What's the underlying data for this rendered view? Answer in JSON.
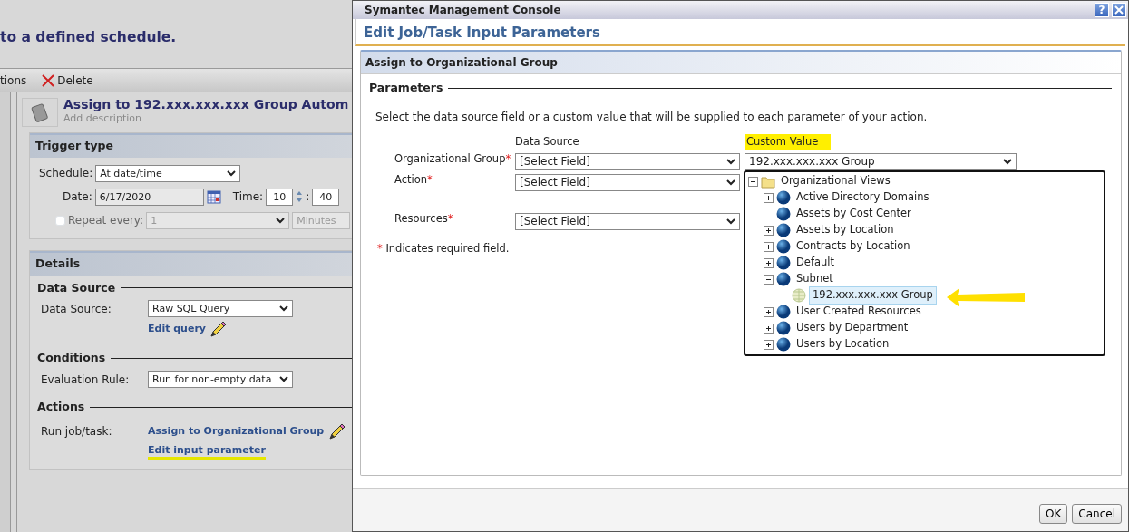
{
  "background_app": {
    "heading": "to a defined schedule.",
    "toolbar": [
      {
        "kind": "text",
        "label": "tions"
      },
      {
        "kind": "delete",
        "label": "Delete"
      }
    ],
    "policy": {
      "title": "Assign to 192.xxx.xxx.xxx Group Autom",
      "description_link": "Add description"
    },
    "trigger": {
      "title": "Trigger type",
      "schedule_label": "Schedule:",
      "schedule_value": "At date/time",
      "date_label": "Date:",
      "date_value": "6/17/2020",
      "time_label": "Time:",
      "hour": "10",
      "separator": ":",
      "minute": "40",
      "repeat_label": "Repeat every:",
      "repeat_checked": false,
      "repeat_value": "1",
      "repeat_unit": "Minutes"
    },
    "details": {
      "title": "Details",
      "data_source": {
        "heading": "Data Source",
        "label": "Data Source:",
        "value": "Raw SQL Query",
        "link": "Edit query"
      },
      "conditions": {
        "heading": "Conditions",
        "label": "Evaluation Rule:",
        "value": "Run for non-empty data"
      },
      "actions": {
        "heading": "Actions",
        "label": "Run job/task:",
        "task_link": "Assign to Organizational Group",
        "param_link": "Edit input parameter",
        "param_link_highlighted": true
      }
    }
  },
  "dialog": {
    "window_title": "Symantec Management Console",
    "help_button": "?",
    "title": "Edit Job/Task Input Parameters",
    "panel_title": "Assign to Organizational Group",
    "section": "Parameters",
    "instructions": "Select the data source field or a custom value that will be supplied to each parameter of your action.",
    "data_source_header": "Data Source",
    "custom_value_header": {
      "text": "Custom Value",
      "highlighted": true
    },
    "parameters": [
      {
        "label": "Organizational Group",
        "required_mark": "*",
        "data_source": "[Select Field]",
        "custom_value": "192.xxx.xxx.xxx Group"
      },
      {
        "label": "Action",
        "required_mark": "*",
        "data_source": "[Select Field]"
      },
      {
        "label": "Resources",
        "required_mark": "*",
        "data_source": "[Select Field]"
      }
    ],
    "required_note": {
      "mark": "*",
      "text": "Indicates required field."
    },
    "tree": [
      {
        "label": "Organizational Views",
        "kind": "folder",
        "expanded": true,
        "selected": false,
        "children": [
          {
            "label": "Active Directory Domains",
            "kind": "view",
            "expanded": false,
            "selected": false
          },
          {
            "label": "Assets by Cost Center",
            "kind": "view",
            "selected": false
          },
          {
            "label": "Assets by Location",
            "kind": "view",
            "expanded": false,
            "selected": false
          },
          {
            "label": "Contracts by Location",
            "kind": "view",
            "expanded": false,
            "selected": false
          },
          {
            "label": "Default",
            "kind": "view",
            "expanded": false,
            "selected": false
          },
          {
            "label": "Subnet",
            "kind": "view",
            "expanded": true,
            "selected": false,
            "children": [
              {
                "label": "192.xxx.xxx.xxx Group",
                "kind": "group",
                "selected": true,
                "annotated": true
              }
            ]
          },
          {
            "label": "User Created Resources",
            "kind": "view",
            "expanded": false,
            "selected": false
          },
          {
            "label": "Users by Department",
            "kind": "view",
            "expanded": false,
            "selected": false
          },
          {
            "label": "Users by Location",
            "kind": "view",
            "expanded": false,
            "selected": false
          }
        ]
      }
    ],
    "buttons": [
      "OK",
      "Cancel"
    ]
  }
}
